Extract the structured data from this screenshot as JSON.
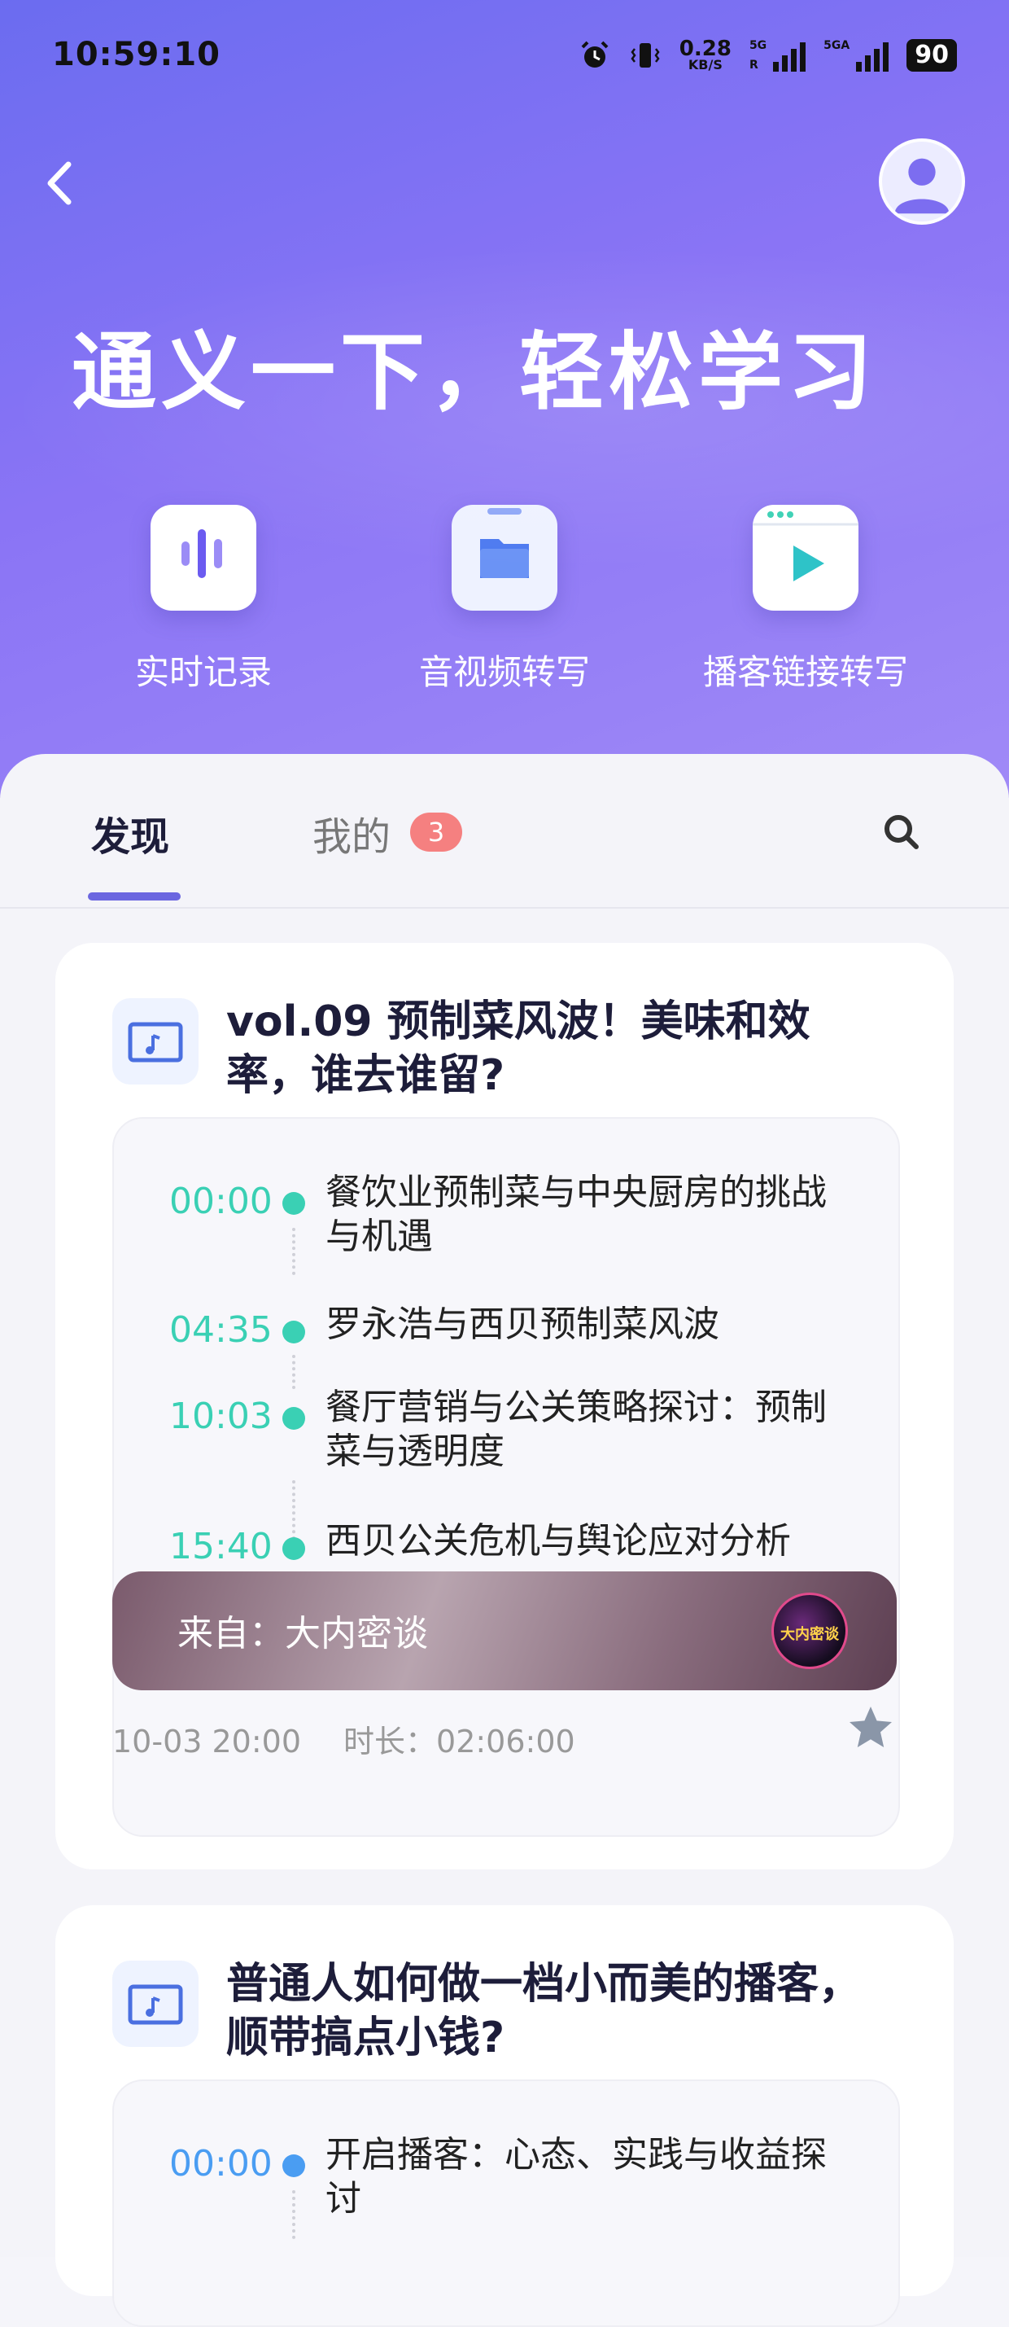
{
  "status_bar": {
    "time": "10:59:10",
    "net_speed": "0.28",
    "net_unit": "KB/S",
    "sim1_tag": "5G",
    "sim1_sub": "R",
    "sim2_tag": "5GA",
    "battery": "90"
  },
  "header": {
    "title": "通义一下，轻松学习"
  },
  "tools": [
    {
      "label": "实时记录",
      "icon": "voice-icon"
    },
    {
      "label": "音视频转写",
      "icon": "folder-icon"
    },
    {
      "label": "播客链接转写",
      "icon": "play-icon"
    }
  ],
  "tabs": {
    "discover": "发现",
    "mine": "我的",
    "mine_badge": "3"
  },
  "cards": [
    {
      "title": "vol.09 预制菜风波！美味和效率，谁去谁留?",
      "chapters": [
        {
          "time": "00:00",
          "text": "餐饮业预制菜与中央厨房的挑战与机遇"
        },
        {
          "time": "04:35",
          "text": "罗永浩与西贝预制菜风波"
        },
        {
          "time": "10:03",
          "text": "餐厅营销与公关策略探讨：预制菜与透明度"
        },
        {
          "time": "15:40",
          "text": "西贝公关危机与舆论应对分析"
        }
      ],
      "source_label": "来自：大内密谈",
      "source_logo_text": "大内密谈",
      "date": "10-03 20:00",
      "duration": "时长：02:06:00"
    },
    {
      "title": "普通人如何做一档小而美的播客，顺带搞点小钱?",
      "chapters": [
        {
          "time": "00:00",
          "text": "开启播客：心态、实践与收益探讨"
        }
      ]
    }
  ],
  "colors": {
    "accent": "#6b66e0",
    "timestamp_green": "#3ad0b4",
    "timestamp_blue": "#4a9df2",
    "badge_red": "#f58080"
  }
}
